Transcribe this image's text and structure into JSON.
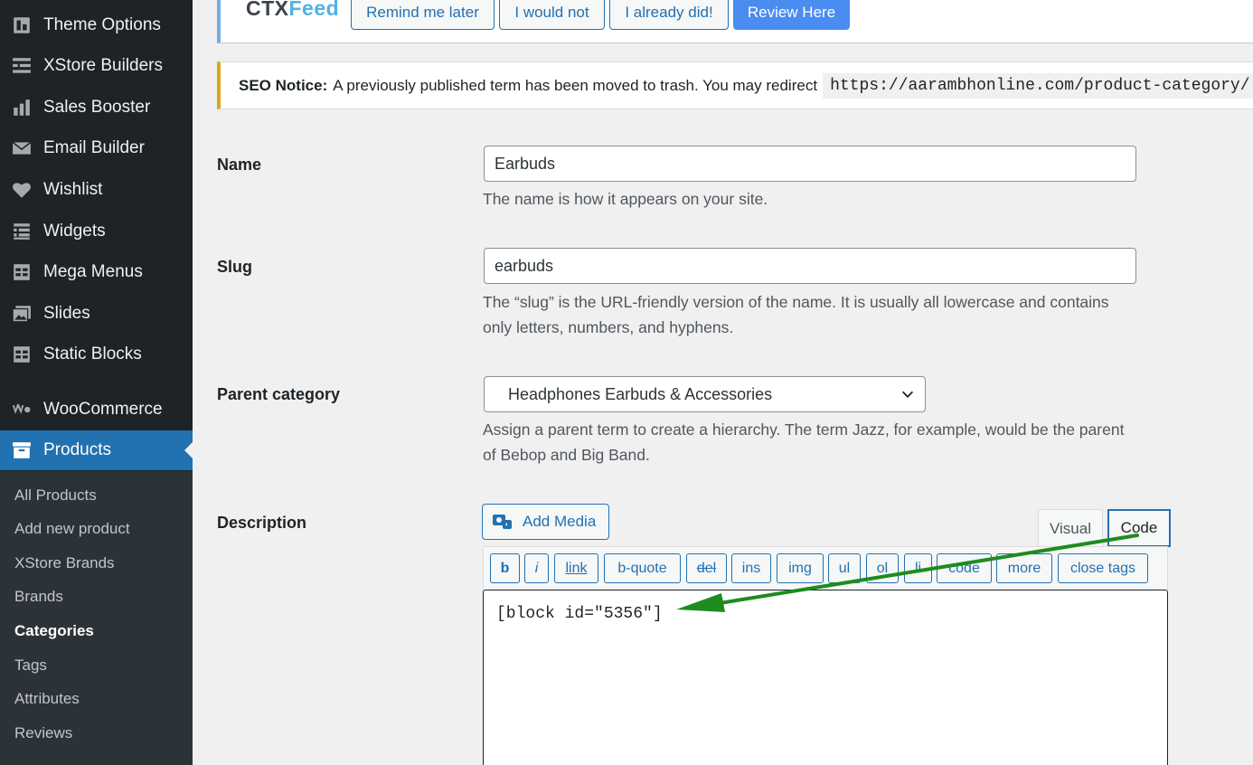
{
  "sidebar": {
    "items": [
      {
        "label": "Theme Options",
        "icon": "theme-options-icon"
      },
      {
        "label": "XStore Builders",
        "icon": "builders-icon"
      },
      {
        "label": "Sales Booster",
        "icon": "bar-chart-icon"
      },
      {
        "label": "Email Builder",
        "icon": "envelope-icon"
      },
      {
        "label": "Wishlist",
        "icon": "heart-icon"
      },
      {
        "label": "Widgets",
        "icon": "widgets-icon"
      },
      {
        "label": "Mega Menus",
        "icon": "table-icon"
      },
      {
        "label": "Slides",
        "icon": "slides-icon"
      },
      {
        "label": "Static Blocks",
        "icon": "table-icon"
      },
      {
        "label": "WooCommerce",
        "icon": "woocommerce-icon"
      },
      {
        "label": "Products",
        "icon": "archive-box-icon",
        "current": true
      }
    ],
    "submenu": [
      {
        "label": "All Products"
      },
      {
        "label": "Add new product"
      },
      {
        "label": "XStore Brands"
      },
      {
        "label": "Brands"
      },
      {
        "label": "Categories",
        "active": true
      },
      {
        "label": "Tags"
      },
      {
        "label": "Attributes"
      },
      {
        "label": "Reviews"
      }
    ]
  },
  "review_bar": {
    "logo_part1": "CTX",
    "logo_part2": "Feed",
    "remind_later": "Remind me later",
    "would_not": "I would not",
    "already_did": "I already did!",
    "review_here": "Review Here"
  },
  "seo_notice": {
    "title": "SEO Notice:",
    "text": "A previously published term has been moved to trash. You may redirect",
    "url": "https://aarambhonline.com/product-category/"
  },
  "form": {
    "name_label": "Name",
    "name_value": "Earbuds",
    "name_help": "The name is how it appears on your site.",
    "slug_label": "Slug",
    "slug_value": "earbuds",
    "slug_help": "The “slug” is the URL-friendly version of the name. It is usually all lowercase and contains only letters, numbers, and hyphens.",
    "parent_label": "Parent category",
    "parent_value": "Headphones Earbuds & Accessories",
    "parent_help": "Assign a parent term to create a hierarchy. The term Jazz, for example, would be the parent of Bebop and Big Band.",
    "description_label": "Description"
  },
  "editor": {
    "add_media": "Add Media",
    "tab_visual": "Visual",
    "tab_code": "Code",
    "toolbar": [
      "b",
      "i",
      "link",
      "b-quote",
      "del",
      "ins",
      "img",
      "ul",
      "ol",
      "li",
      "code",
      "more",
      "close tags"
    ],
    "content": "[block id=\"5356\"]"
  },
  "colors": {
    "sidebar_bg": "#1d2327",
    "accent": "#2271b1",
    "annotation_arrow": "#1e8c1e"
  }
}
